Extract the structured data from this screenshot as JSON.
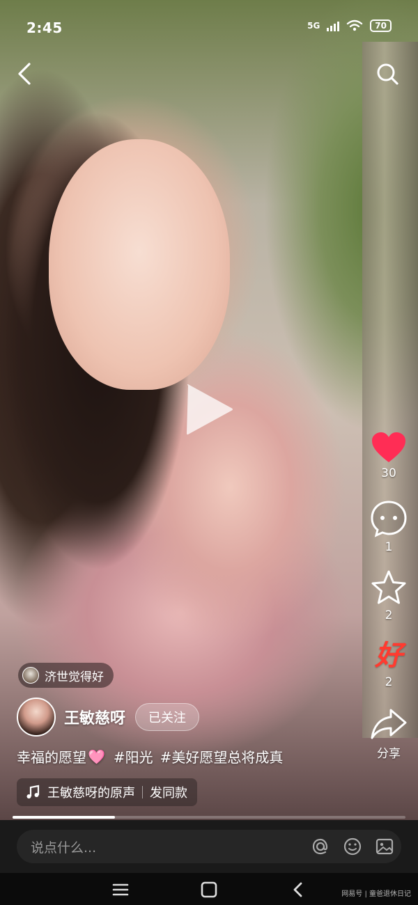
{
  "status_bar": {
    "time": "2:45",
    "network": "5G",
    "battery": "70"
  },
  "video": {
    "progress": 0.26
  },
  "actions": {
    "like_count": "30",
    "comment_count": "1",
    "favorite_count": "2",
    "good_label": "好",
    "good_count": "2",
    "share_label": "分享"
  },
  "friend_tag": {
    "text": "济世觉得好"
  },
  "author": {
    "name": "王敏慈呀",
    "follow_label": "已关注"
  },
  "caption": {
    "text": "幸福的愿望",
    "heart": "🩷",
    "tag1": "#阳光",
    "tag2": "#美好愿望总将成真"
  },
  "music": {
    "title": "王敏慈呀的原声",
    "action": "发同款"
  },
  "comment": {
    "placeholder": "说点什么..."
  },
  "watermark": "网易号 | 童爸退休日记",
  "colors": {
    "like": "#ff2d55",
    "good": "#ff3b30",
    "comment_bar": "#1a1a1a"
  }
}
